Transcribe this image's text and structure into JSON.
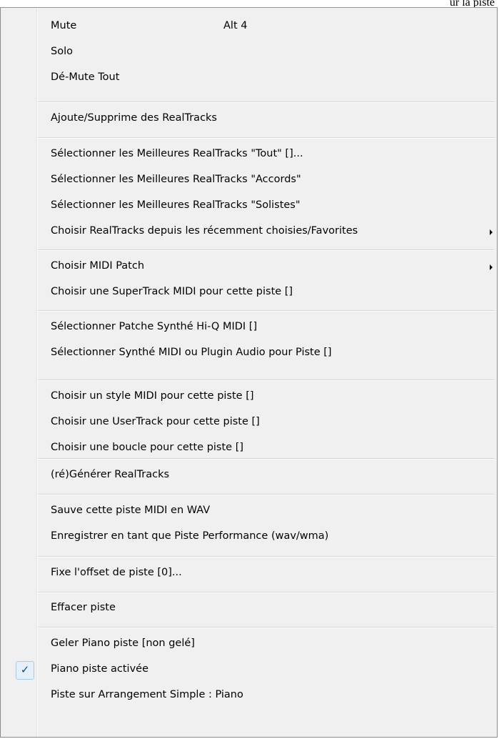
{
  "page_fragment": "ur la piste",
  "menu": {
    "items": [
      {
        "label": "Mute",
        "shortcut": "Alt 4"
      },
      {
        "label": "Solo"
      },
      {
        "label": "Dé-Mute Tout"
      },
      {
        "label": "Ajoute/Supprime des RealTracks"
      },
      {
        "label": "Sélectionner les Meilleures RealTracks \"Tout\" []..."
      },
      {
        "label": "Sélectionner les Meilleures RealTracks \"Accords\""
      },
      {
        "label": "Sélectionner les Meilleures RealTracks \"Solistes\""
      },
      {
        "label": "Choisir RealTracks depuis les récemment choisies/Favorites",
        "submenu": true
      },
      {
        "label": "Choisir MIDI Patch",
        "submenu": true
      },
      {
        "label": "Choisir une SuperTrack MIDI pour cette piste  []"
      },
      {
        "label": "Sélectionner Patche Synthé Hi-Q MIDI []"
      },
      {
        "label": "Sélectionner Synthé MIDI  ou Plugin Audio pour Piste []"
      },
      {
        "label": "Choisir un style MIDI pour cette piste  []"
      },
      {
        "label": "Choisir une UserTrack pour cette piste  []"
      },
      {
        "label": "Choisir une boucle pour cette piste  []"
      },
      {
        "label": "(ré)Générer RealTracks"
      },
      {
        "label": "Sauve cette piste MIDI en WAV"
      },
      {
        "label": "Enregistrer en tant que Piste Performance (wav/wma)"
      },
      {
        "label": "Fixe l'offset de piste [0]..."
      },
      {
        "label": "Effacer piste"
      },
      {
        "label": "Geler Piano piste    [non gelé]"
      },
      {
        "label": "Piano piste activée",
        "checked": true
      },
      {
        "label": "Piste sur Arrangement Simple : Piano"
      }
    ],
    "check_mark": "✓"
  },
  "colors": {
    "menu_background": "#f0f0f0",
    "border": "#8a8a8a",
    "check_highlight": "#e6f0fa"
  }
}
